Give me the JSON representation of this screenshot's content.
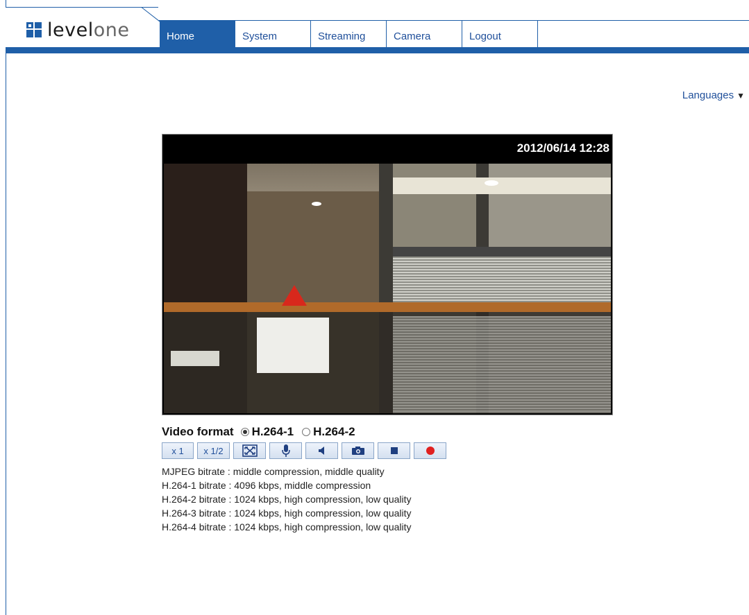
{
  "brand": {
    "logo_main": "level",
    "logo_suffix": "one"
  },
  "nav": {
    "items": [
      {
        "label": "Home",
        "active": true
      },
      {
        "label": "System",
        "active": false
      },
      {
        "label": "Streaming",
        "active": false
      },
      {
        "label": "Camera",
        "active": false
      },
      {
        "label": "Logout",
        "active": false
      }
    ]
  },
  "languages": {
    "label": "Languages",
    "arrow": "▼"
  },
  "video": {
    "timestamp": "2012/06/14 12:28"
  },
  "controls": {
    "video_format_label": "Video format",
    "format_options": [
      {
        "label": "H.264-1",
        "selected": true
      },
      {
        "label": "H.264-2",
        "selected": false
      }
    ],
    "buttons": [
      {
        "label": "x 1"
      },
      {
        "label": "x 1/2"
      },
      {
        "icon": "fullscreen-icon"
      },
      {
        "icon": "microphone-icon"
      },
      {
        "icon": "speaker-icon"
      },
      {
        "icon": "camera-snapshot-icon"
      },
      {
        "icon": "stop-icon"
      },
      {
        "icon": "record-icon"
      }
    ]
  },
  "bitrates": [
    "MJPEG bitrate : middle compression, middle quality",
    "H.264-1 bitrate : 4096 kbps, middle compression",
    "H.264-2 bitrate : 1024 kbps, high compression, low quality",
    "H.264-3 bitrate : 1024 kbps, high compression, low quality",
    "H.264-4 bitrate : 1024 kbps, high compression, low quality"
  ],
  "colors": {
    "brand_blue": "#1f5fa8",
    "record_red": "#e0201f"
  }
}
